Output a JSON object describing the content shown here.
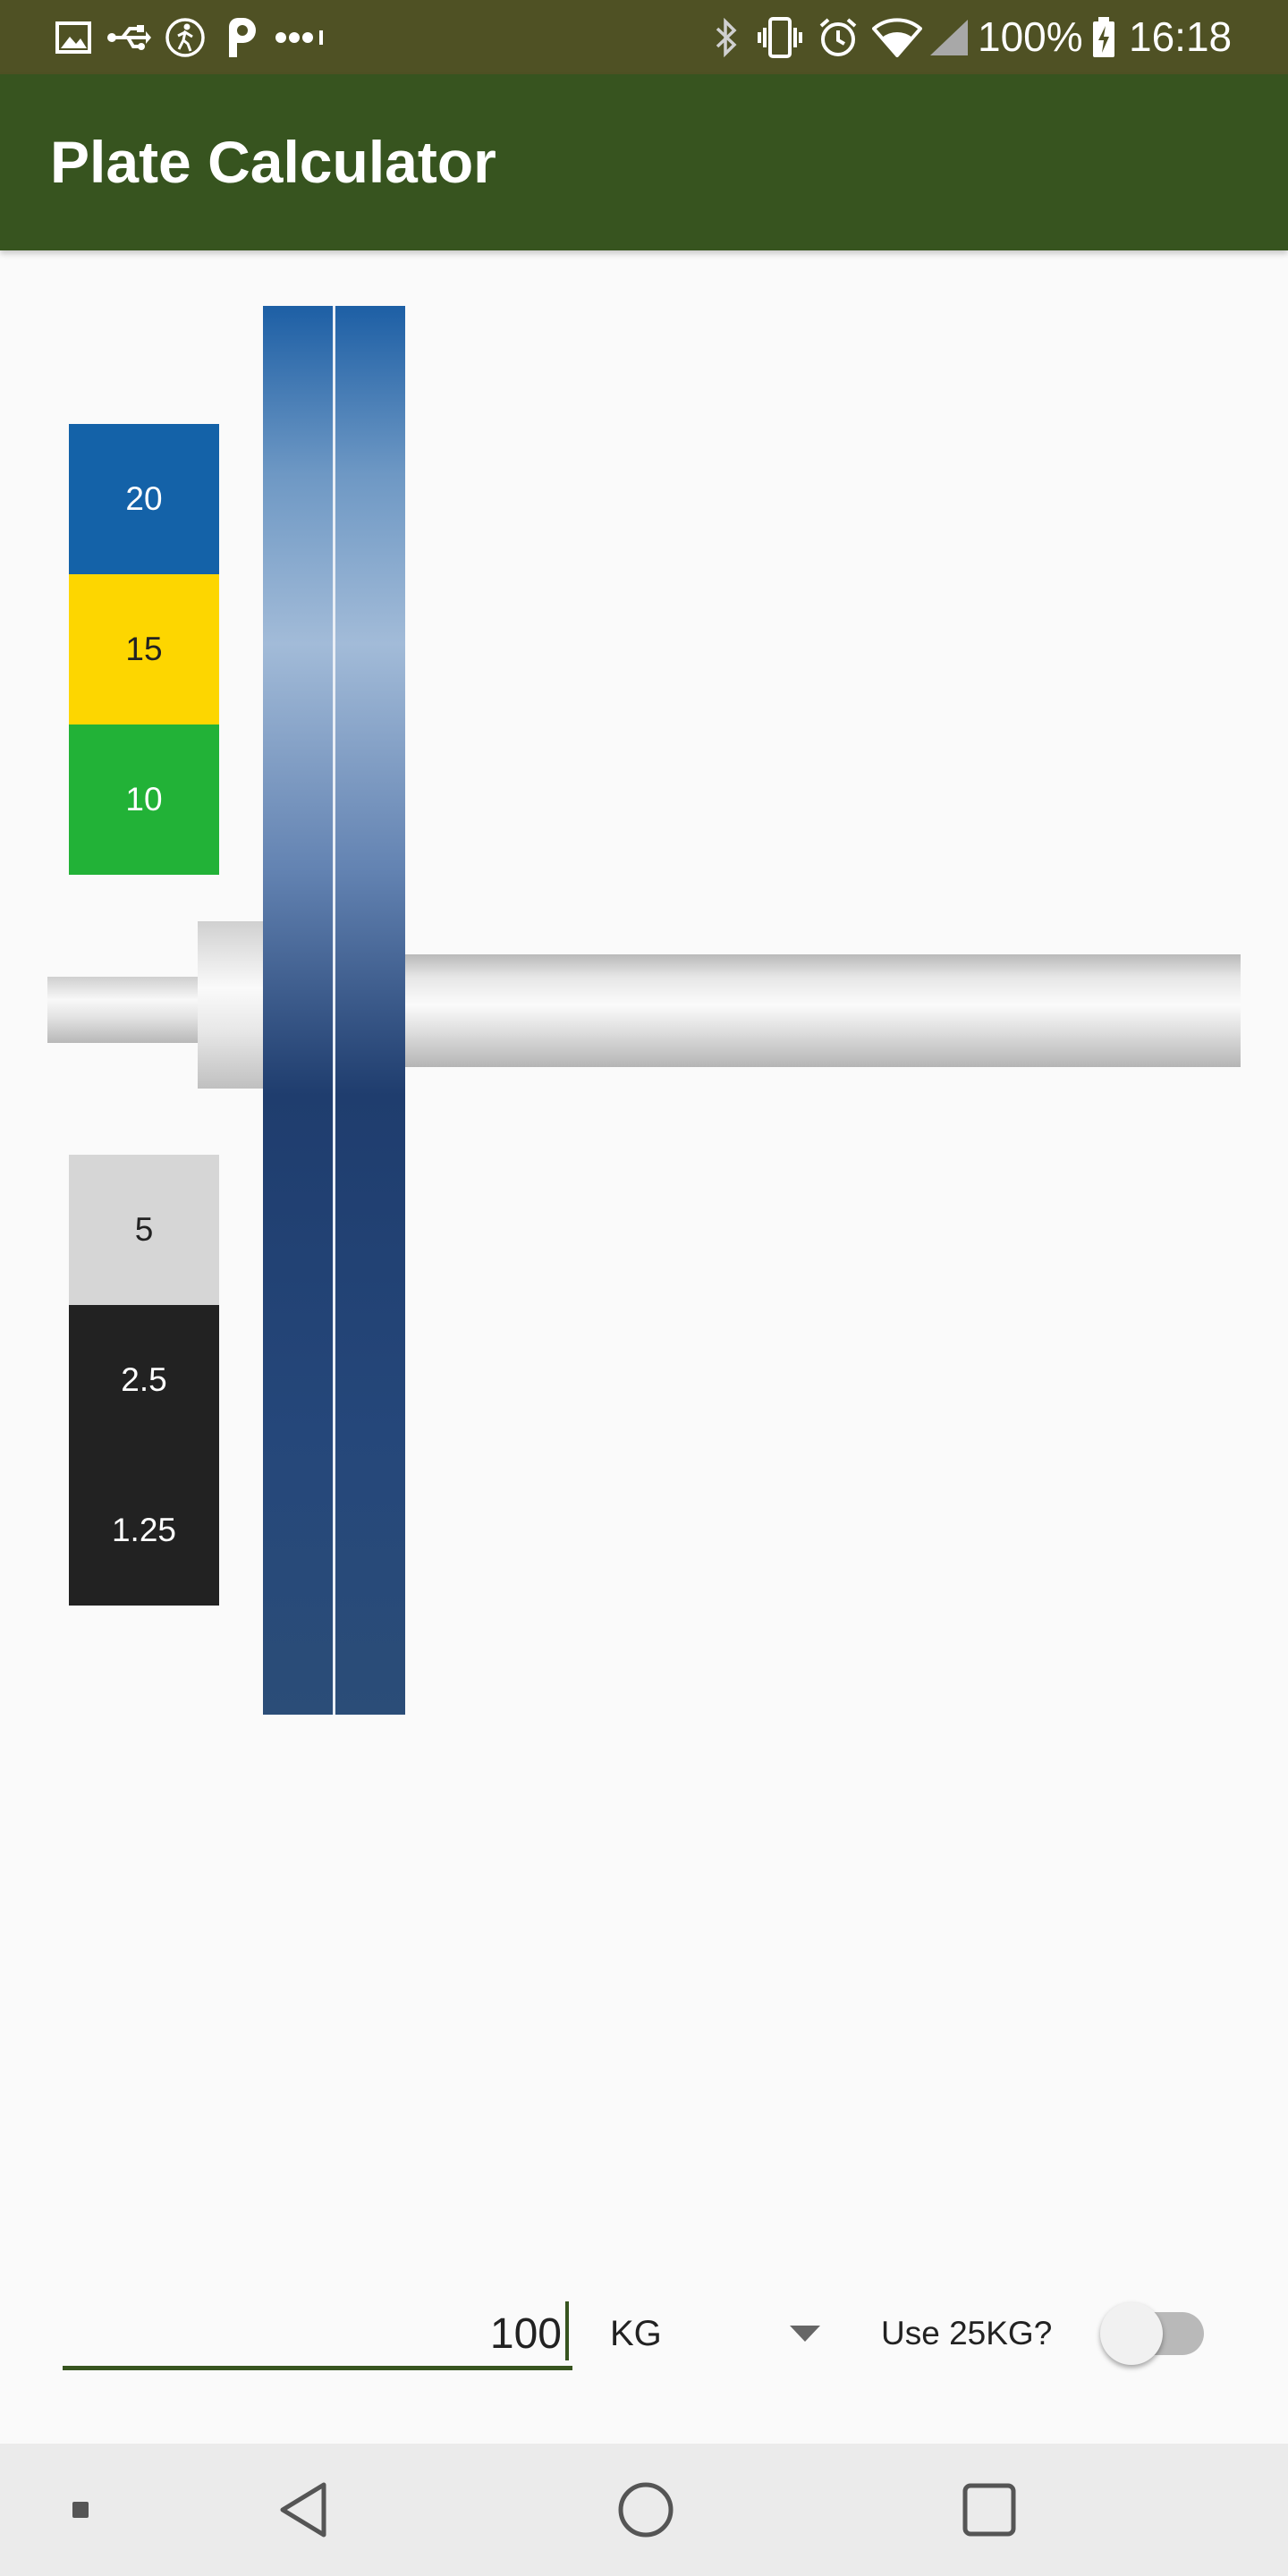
{
  "status_bar": {
    "battery_text": "100%",
    "time": "16:18",
    "left_icons": [
      "image-icon",
      "usb-icon",
      "activity-icon",
      "parking-icon",
      "more-dots-icon"
    ],
    "right_icons": [
      "bluetooth-icon",
      "vibrate-icon",
      "alarm-icon",
      "wifi-icon",
      "cell-signal-icon",
      "battery-charging-icon"
    ]
  },
  "app_bar": {
    "title": "Plate Calculator"
  },
  "colors": {
    "status_bar": "#4f5124",
    "app_bar": "#37541f",
    "accent": "#37541f",
    "plate_20": "#1462a8",
    "plate_15": "#fdd600",
    "plate_10": "#22b237",
    "plate_5": "#d6d6d6",
    "plate_2_5": "#222222",
    "plate_1_25": "#222222",
    "loaded_plate": "#25477a"
  },
  "legend": [
    {
      "label": "20",
      "color": "#1462a8",
      "text_color": "#ffffff"
    },
    {
      "label": "15",
      "color": "#fdd600",
      "text_color": "#222222"
    },
    {
      "label": "10",
      "color": "#22b237",
      "text_color": "#ffffff"
    },
    {
      "label": "5",
      "color": "#d6d6d6",
      "text_color": "#222222"
    },
    {
      "label": "2.5",
      "color": "#222222",
      "text_color": "#ffffff"
    },
    {
      "label": "1.25",
      "color": "#222222",
      "text_color": "#ffffff"
    }
  ],
  "loaded_plates": [
    {
      "weight": "20"
    },
    {
      "weight": "20"
    }
  ],
  "controls": {
    "weight_value": "100",
    "unit": "KG",
    "toggle_label": "Use 25KG?",
    "toggle_on": false
  },
  "nav_bar": {
    "icons": [
      "square-small-icon",
      "back-icon",
      "home-icon",
      "recents-icon"
    ]
  }
}
